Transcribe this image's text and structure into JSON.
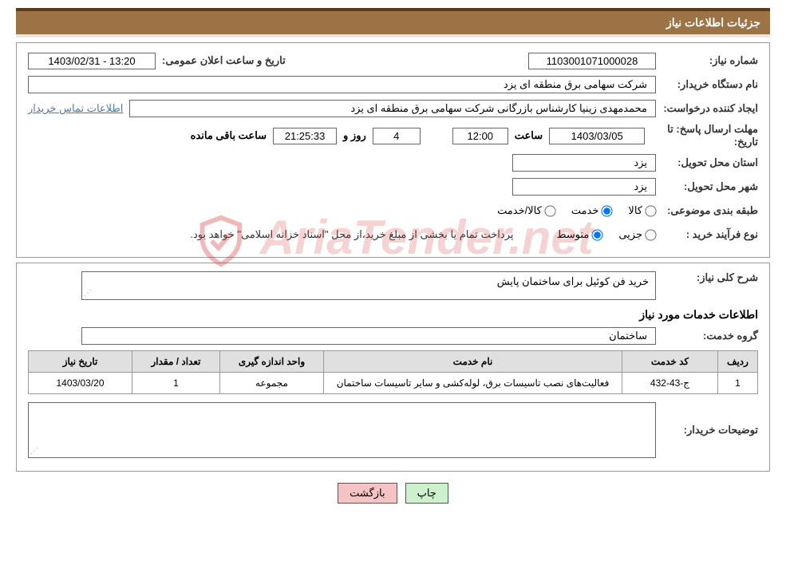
{
  "header": {
    "title": "جزئیات اطلاعات نیاز"
  },
  "info": {
    "need_no_label": "شماره نیاز:",
    "need_no": "1103001071000028",
    "announce_label": "تاریخ و ساعت اعلان عمومی:",
    "announce_value": "13:20 - 1403/02/31",
    "buyer_label": "نام دستگاه خریدار:",
    "buyer_value": "شرکت سهامی برق منطقه ای یزد",
    "requester_label": "ایجاد کننده درخواست:",
    "requester_value": "محمدمهدی زینیا کارشناس بازرگانی شرکت سهامی برق منطقه ای یزد",
    "contact_link": "اطلاعات تماس خریدار",
    "deadline_label_a": "مهلت ارسال پاسخ: تا",
    "deadline_label_b": "تاریخ:",
    "deadline_date": "1403/03/05",
    "time_label": "ساعت",
    "deadline_time": "12:00",
    "days_value": "4",
    "days_label": "روز و",
    "countdown": "21:25:33",
    "remaining_label": "ساعت باقی مانده",
    "province_label": "استان محل تحویل:",
    "province_value": "یزد",
    "city_label": "شهر محل تحویل:",
    "city_value": "یزد",
    "class_label": "طبقه بندی موضوعی:",
    "goods_label": "کالا",
    "service_label": "خدمت",
    "mixed_label": "کالا/خدمت",
    "purchase_type_label": "نوع فرآیند خرید :",
    "small_label": "جزیی",
    "medium_label": "متوسط",
    "payment_note": "پرداخت تمام یا بخشی از مبلغ خرید،از محل \"اسناد خزانه اسلامی\" خواهد بود."
  },
  "need": {
    "summary_label": "شرح کلی نیاز:",
    "summary_value": "خرید فن کوئیل برای ساختمان پایش",
    "services_title": "اطلاعات خدمات مورد نیاز",
    "group_label": "گروه خدمت:",
    "group_value": "ساختمان",
    "table": {
      "headers": [
        "ردیف",
        "کد خدمت",
        "نام خدمت",
        "واحد اندازه گیری",
        "تعداد / مقدار",
        "تاریخ نیاز"
      ],
      "rows": [
        {
          "idx": "1",
          "code": "ج-43-432",
          "name": "فعالیت‌های نصب تاسیسات برق، لوله‌کشی و سایر تاسیسات ساختمان",
          "unit": "مجموعه",
          "qty": "1",
          "date": "1403/03/20"
        }
      ]
    },
    "buyer_notes_label": "توضیحات خریدار:",
    "buyer_notes_value": ""
  },
  "actions": {
    "print": "چاپ",
    "back": "بازگشت"
  },
  "watermark": "AriaTender.net"
}
